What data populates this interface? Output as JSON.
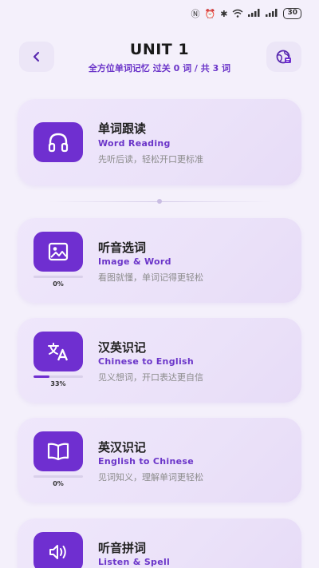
{
  "status_bar": {
    "battery": "30"
  },
  "header": {
    "title": "UNIT 1",
    "subtitle": "全方位单词记忆 过关 0 词 / 共 3 词"
  },
  "cards": [
    {
      "title": "单词跟读",
      "en": "Word Reading",
      "desc": "先听后读，轻松开口更标准",
      "icon": "headphones-icon"
    },
    {
      "title": "听音选词",
      "en": "Image & Word",
      "desc": "看图就懂，单词记得更轻松",
      "icon": "image-icon",
      "progress": 0,
      "progress_text": "0%"
    },
    {
      "title": "汉英识记",
      "en": "Chinese to English",
      "desc": "见义想词，开口表达更自信",
      "icon": "translate-icon",
      "progress": 0.33,
      "progress_text": "33%"
    },
    {
      "title": "英汉识记",
      "en": "English to Chinese",
      "desc": "见词知义，理解单词更轻松",
      "icon": "book-icon",
      "progress": 0,
      "progress_text": "0%"
    },
    {
      "title": "听音拼词",
      "en": "Listen & Spell",
      "icon": "speaker-icon"
    }
  ],
  "colors": {
    "accent": "#6f2fd0",
    "accent_text": "#6b35c9",
    "card_bg": "#ede5fa",
    "page_bg": "#f4f0fb"
  }
}
